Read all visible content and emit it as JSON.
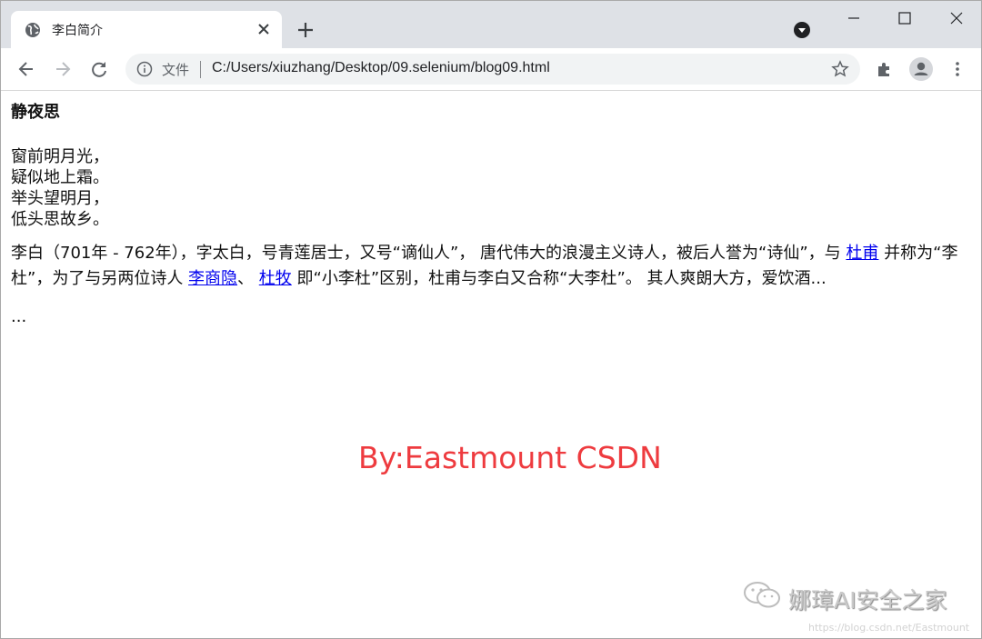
{
  "browser": {
    "tab_title": "李白简介",
    "address": {
      "scheme_label": "文件",
      "url": "C:/Users/xiuzhang/Desktop/09.selenium/blog09.html"
    },
    "icons": [
      "globe-icon",
      "close-icon",
      "plus-icon",
      "chevron-down-icon",
      "minimize-icon",
      "maximize-icon",
      "close-window-icon",
      "back-arrow-icon",
      "forward-arrow-icon",
      "reload-icon",
      "info-icon",
      "star-icon",
      "extensions-icon",
      "avatar-icon",
      "menu-dots-icon"
    ]
  },
  "page": {
    "heading": "静夜思",
    "poem": [
      "窗前明月光，",
      "疑似地上霜。",
      "举头望明月，",
      "低头思故乡。"
    ],
    "bio": {
      "part1": "李白（701年 - 762年），字太白，号青莲居士，又号“谪仙人”， 唐代伟大的浪漫主义诗人，被后人誉为“诗仙”，与 ",
      "link1": "杜甫",
      "part2": " 并称为“李杜”，为了与另两位诗人 ",
      "link2": "李商隐",
      "part3": "、 ",
      "link3": "杜牧",
      "part4": " 即“小李杜”区别，杜甫与李白又合称“大李杜”。 其人爽朗大方，爱饮酒..."
    },
    "ellipsis": "..."
  },
  "overlay": {
    "watermark": "By:Eastmount CSDN",
    "brand": "娜璋AI安全之家",
    "credit": "https://blog.csdn.net/Eastmount",
    "colors": {
      "watermark": "#ee3b3f",
      "link": "#0000ee"
    }
  }
}
